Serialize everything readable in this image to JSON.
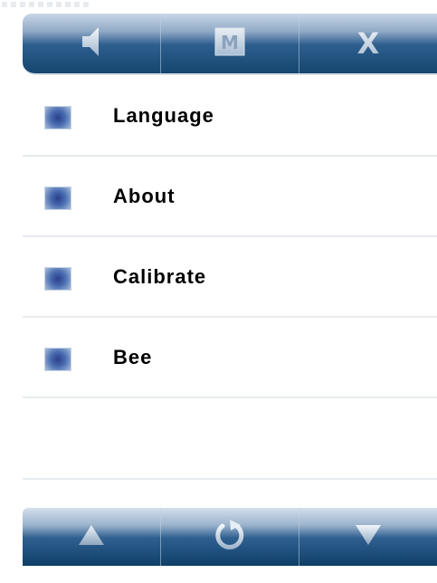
{
  "top_toolbar": {
    "buttons": [
      {
        "icon": "speaker-icon"
      },
      {
        "icon": "menu-m-icon",
        "glyph": "M"
      },
      {
        "icon": "close-icon",
        "glyph": "X"
      }
    ]
  },
  "menu": {
    "items": [
      {
        "label": "Language"
      },
      {
        "label": "About"
      },
      {
        "label": "Calibrate"
      },
      {
        "label": "Bee"
      }
    ]
  },
  "bottom_toolbar": {
    "buttons": [
      {
        "icon": "arrow-up-icon"
      },
      {
        "icon": "refresh-icon"
      },
      {
        "icon": "arrow-down-icon"
      }
    ]
  },
  "colors": {
    "bar_dark": "#14466f",
    "bar_light": "#c9d7e6",
    "bullet": "#4a6cb0",
    "divider": "#e8ecef"
  }
}
